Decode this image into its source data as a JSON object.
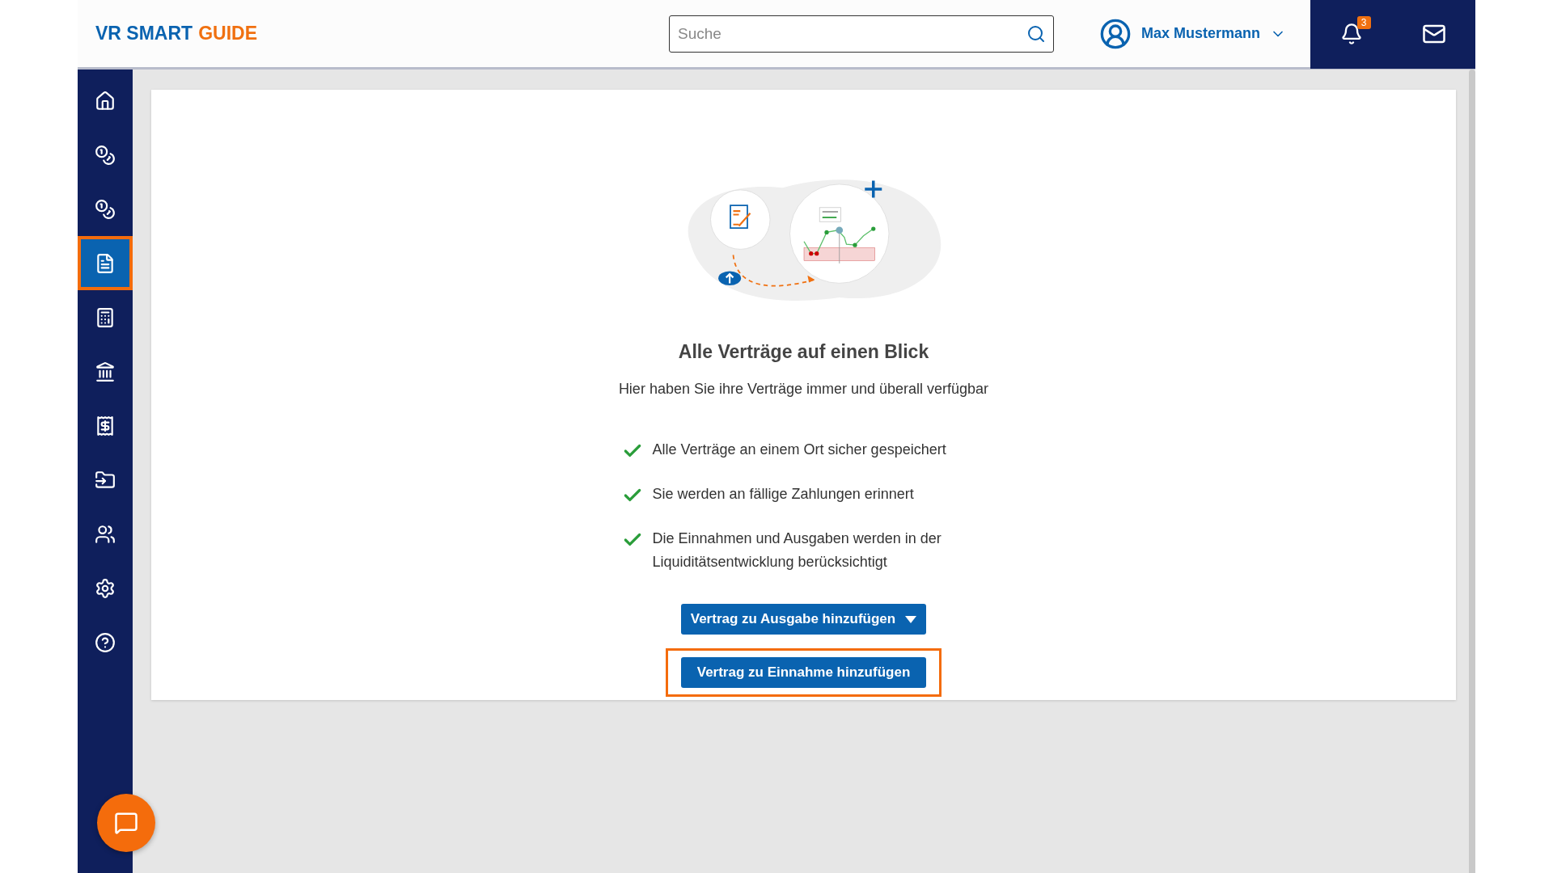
{
  "header": {
    "logo": {
      "part_1": "VR SMART",
      "part_2": "GUIDE"
    },
    "search": {
      "placeholder": "Suche"
    },
    "user": {
      "name": "Max Mustermann"
    },
    "notifications": {
      "badge": "3"
    }
  },
  "sidebar": {
    "items": [
      {
        "selected": false
      },
      {
        "selected": false
      },
      {
        "selected": false
      },
      {
        "selected": true
      },
      {
        "selected": false
      },
      {
        "selected": false
      },
      {
        "selected": false
      },
      {
        "selected": false
      },
      {
        "selected": false
      },
      {
        "selected": false
      },
      {
        "selected": false
      }
    ]
  },
  "content": {
    "title": "Alle Verträge auf einen Blick",
    "subtitle": "Hier haben Sie ihre Verträge immer und überall verfügbar",
    "features": [
      "Alle Verträge an einem Ort sicher gespeichert",
      "Sie werden an fällige Zahlungen erinnert",
      "Die Einnahmen und Ausgaben werden in der Liquiditätsentwicklung berücksichtigt"
    ],
    "buttons": [
      {
        "label": "Vertrag zu Ausgabe hinzufügen",
        "kind": "dropdown",
        "highlighted": false
      },
      {
        "label": "Vertrag zu Einnahme hinzufügen",
        "kind": "plain",
        "highlighted": true
      }
    ]
  }
}
